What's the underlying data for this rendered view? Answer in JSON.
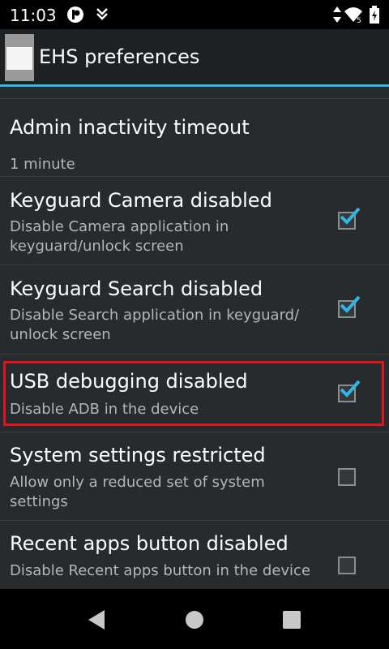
{
  "status_bar": {
    "time": "11:03"
  },
  "action_bar": {
    "title": "EHS preferences"
  },
  "preferences": [
    {
      "title": "Admin inactivity timeout",
      "summary": "1 minute",
      "has_checkbox": false
    },
    {
      "title": "Keyguard Camera disabled",
      "summary": "Disable Camera application in keyguard/unlock screen",
      "has_checkbox": true,
      "checked": true
    },
    {
      "title": "Keyguard Search disabled",
      "summary": "Disable Search application in keyguard/ unlock screen",
      "has_checkbox": true,
      "checked": true
    },
    {
      "title": "USB debugging disabled",
      "summary": "Disable ADB in the device",
      "has_checkbox": true,
      "checked": true
    },
    {
      "title": "System settings restricted",
      "summary": "Allow only a reduced set of system settings",
      "has_checkbox": true,
      "checked": false
    },
    {
      "title": "Recent apps button disabled",
      "summary": "Disable Recent apps button in the device",
      "has_checkbox": true,
      "checked": false
    }
  ],
  "colors": {
    "accent": "#33b5e5",
    "highlight": "#e0151b",
    "background": "#272b2d"
  }
}
